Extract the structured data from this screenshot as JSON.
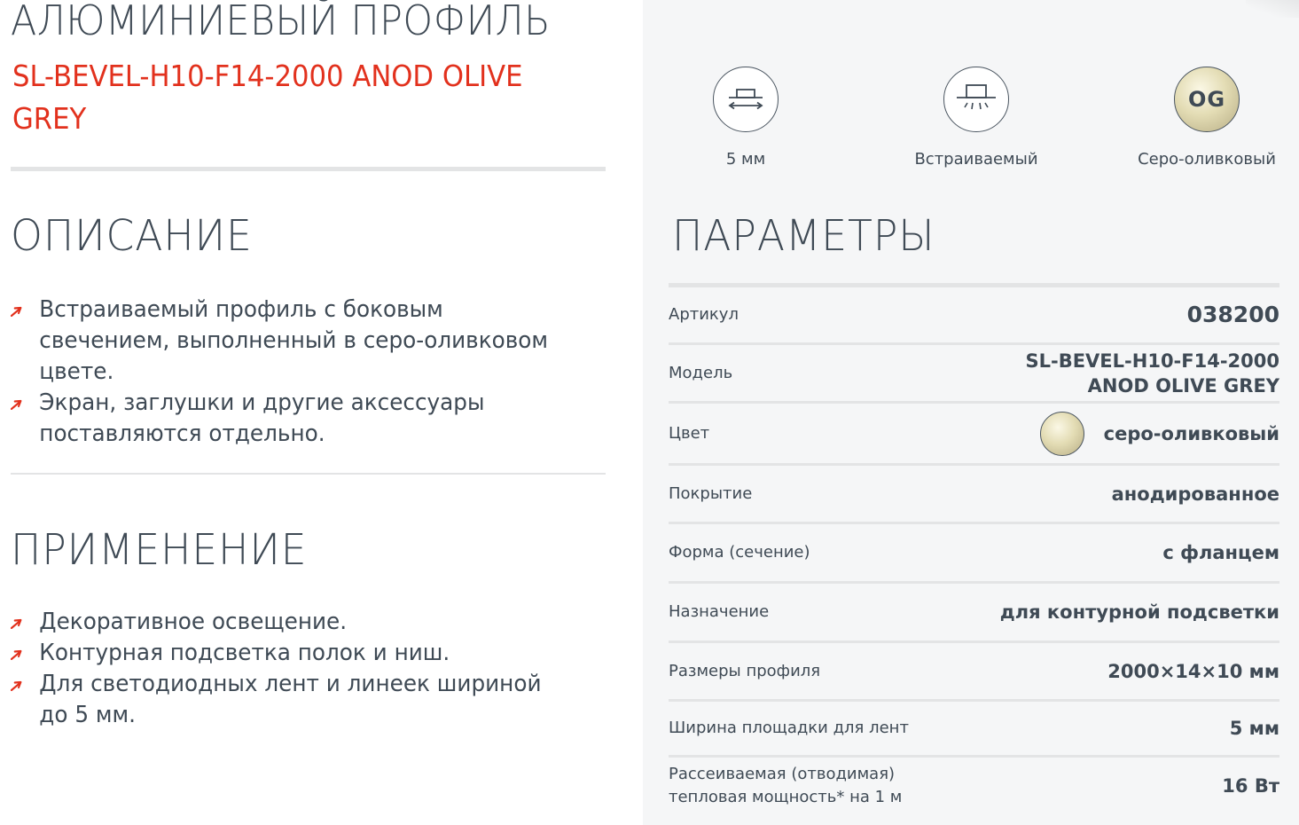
{
  "header": {
    "title": "АЛЮМИНИЕВЫЙ ПРОФИЛЬ",
    "subtitle": "SL-BEVEL-H10-F14-2000 ANOD OLIVE GREY"
  },
  "description": {
    "heading": "ОПИСАНИЕ",
    "items": [
      "Встраиваемый профиль с боковым свечением, выполненный в серо-оливковом цвете.",
      "Экран, заглушки и другие аксессуары поставляются отдельно."
    ]
  },
  "application": {
    "heading": "ПРИМЕНЕНИЕ",
    "items": [
      "Декоративное освещение.",
      "Контурная подсветка полок и ниш.",
      "Для светодиодных лент и линеек шириной до 5 мм."
    ]
  },
  "features": [
    {
      "icon": "strip-width-icon",
      "label": "5 мм"
    },
    {
      "icon": "recessed-mount-icon",
      "label": "Встраиваемый"
    },
    {
      "icon": "color-og-icon",
      "code": "OG",
      "label": "Серо-оливковый"
    }
  ],
  "parameters": {
    "heading": "ПАРАМЕТРЫ",
    "rows": [
      {
        "label": "Артикул",
        "value": "038200"
      },
      {
        "label": "Модель",
        "value": "SL-BEVEL-H10-F14-2000 ANOD OLIVE GREY"
      },
      {
        "label": "Цвет",
        "value": "серо-оливковый"
      },
      {
        "label": "Покрытие",
        "value": "анодированное"
      },
      {
        "label": "Форма (сечение)",
        "value": "с фланцем"
      },
      {
        "label": "Назначение",
        "value": "для контурной подсветки"
      },
      {
        "label": "Размеры профиля",
        "value": "2000×14×10 мм"
      },
      {
        "label": "Ширина площадки для лент",
        "value": "5 мм"
      },
      {
        "label": "Рассеиваемая (отводимая) тепловая мощность* на 1 м",
        "value": "16 Вт"
      }
    ]
  },
  "colors": {
    "accent": "#e2311d",
    "text": "#3f4a55",
    "panel": "#f5f6f7",
    "rule": "#e3e4e5"
  }
}
